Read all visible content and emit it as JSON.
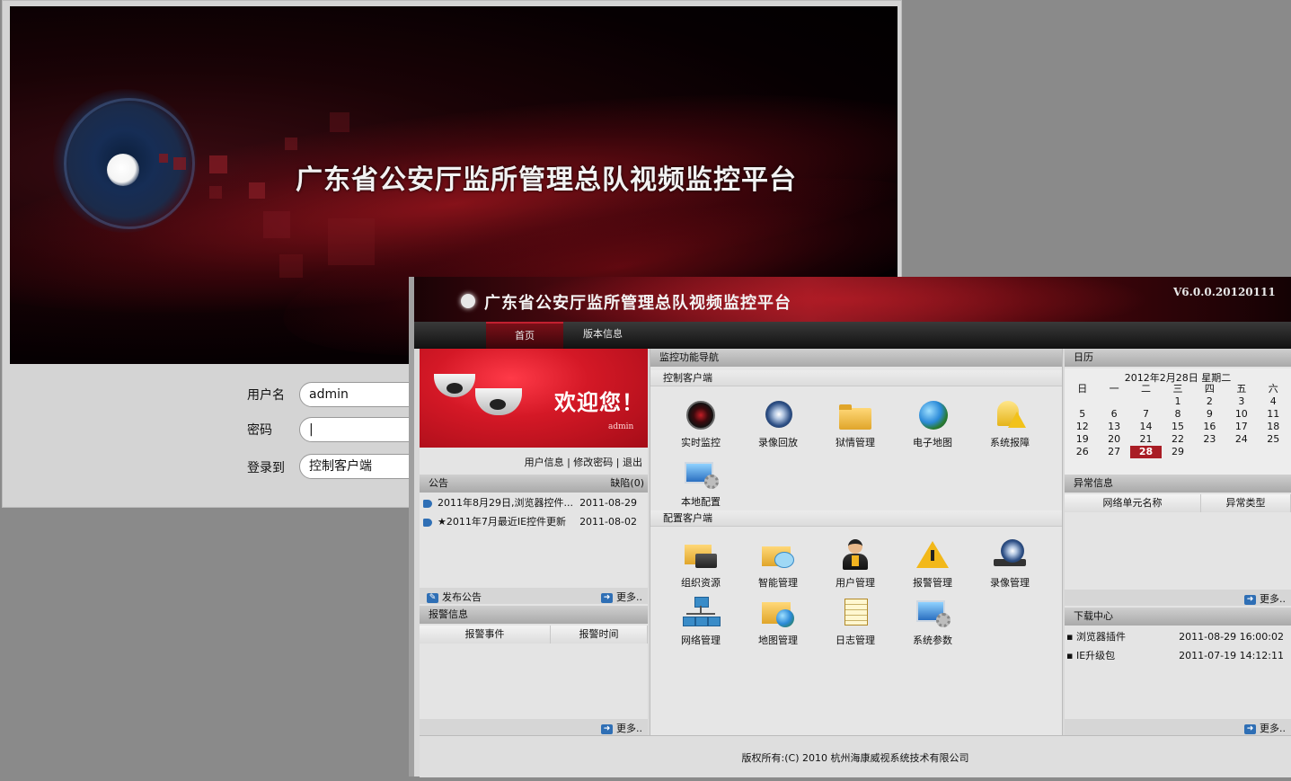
{
  "login": {
    "title": "广东省公安厅监所管理总队视频监控平台",
    "username_label": "用户名",
    "username_value": "admin",
    "password_label": "密码",
    "password_value": "|",
    "login_to_label": "登录到",
    "login_to_value": "控制客户端"
  },
  "main": {
    "title": "广东省公安厅监所管理总队视频监控平台",
    "version": "V6.0.0.20120111",
    "tabs": [
      {
        "label": "首页"
      },
      {
        "label": "版本信息"
      }
    ],
    "welcome": {
      "text": "欢迎您！",
      "user": "admin"
    },
    "user_links": "用户信息 | 修改密码 | 退出",
    "notice": {
      "title": "公告",
      "missing": "缺陷(0)",
      "items": [
        {
          "text": "2011年8月29日,浏览器控件...",
          "date": "2011-08-29"
        },
        {
          "text": "★2011年7月最近IE控件更新",
          "date": "2011-08-02"
        }
      ],
      "publish": "发布公告",
      "more": "更多.."
    },
    "alarm": {
      "title": "报警信息",
      "columns": [
        "报警事件",
        "报警时间"
      ],
      "more": "更多.."
    },
    "nav": {
      "title": "监控功能导航",
      "control_section": "控制客户端",
      "control_items": [
        {
          "label": "实时监控",
          "icon": "camera-icon"
        },
        {
          "label": "录像回放",
          "icon": "film-reel-icon"
        },
        {
          "label": "狱情管理",
          "icon": "folder-icon"
        },
        {
          "label": "电子地图",
          "icon": "globe-icon"
        },
        {
          "label": "系统报障",
          "icon": "warning-bell-icon"
        },
        {
          "label": "本地配置",
          "icon": "monitor-gear-icon"
        }
      ],
      "config_section": "配置客户端",
      "config_items": [
        {
          "label": "组织资源",
          "icon": "server-folder-icon"
        },
        {
          "label": "智能管理",
          "icon": "chat-folder-icon"
        },
        {
          "label": "用户管理",
          "icon": "user-icon"
        },
        {
          "label": "报警管理",
          "icon": "warning-icon"
        },
        {
          "label": "录像管理",
          "icon": "film-reel-icon"
        },
        {
          "label": "网络管理",
          "icon": "network-icon"
        },
        {
          "label": "地图管理",
          "icon": "map-folder-icon"
        },
        {
          "label": "日志管理",
          "icon": "notepad-icon"
        },
        {
          "label": "系统参数",
          "icon": "monitor-gear-icon"
        }
      ]
    },
    "calendar": {
      "title": "日历",
      "date_line": "2012年2月28日  星期二",
      "weekdays": [
        "日",
        "一",
        "二",
        "三",
        "四",
        "五",
        "六"
      ],
      "weeks": [
        [
          "",
          "",
          "",
          "1",
          "2",
          "3",
          "4"
        ],
        [
          "5",
          "6",
          "7",
          "8",
          "9",
          "10",
          "11"
        ],
        [
          "12",
          "13",
          "14",
          "15",
          "16",
          "17",
          "18"
        ],
        [
          "19",
          "20",
          "21",
          "22",
          "23",
          "24",
          "25"
        ],
        [
          "26",
          "27",
          "28",
          "29",
          "",
          "",
          ""
        ]
      ],
      "today": "28"
    },
    "exception": {
      "title": "异常信息",
      "columns": [
        "网络单元名称",
        "异常类型"
      ],
      "more": "更多.."
    },
    "downloads": {
      "title": "下载中心",
      "items": [
        {
          "name": "▪ 浏览器插件",
          "time": "2011-08-29 16:00:02"
        },
        {
          "name": "▪ IE升级包",
          "time": "2011-07-19 14:12:11"
        }
      ],
      "more": "更多.."
    },
    "footer": "版权所有:(C) 2010 杭州海康威视系统技术有限公司"
  },
  "colors": {
    "brand_red": "#a91d25",
    "link_blue": "#2f6fb5"
  }
}
